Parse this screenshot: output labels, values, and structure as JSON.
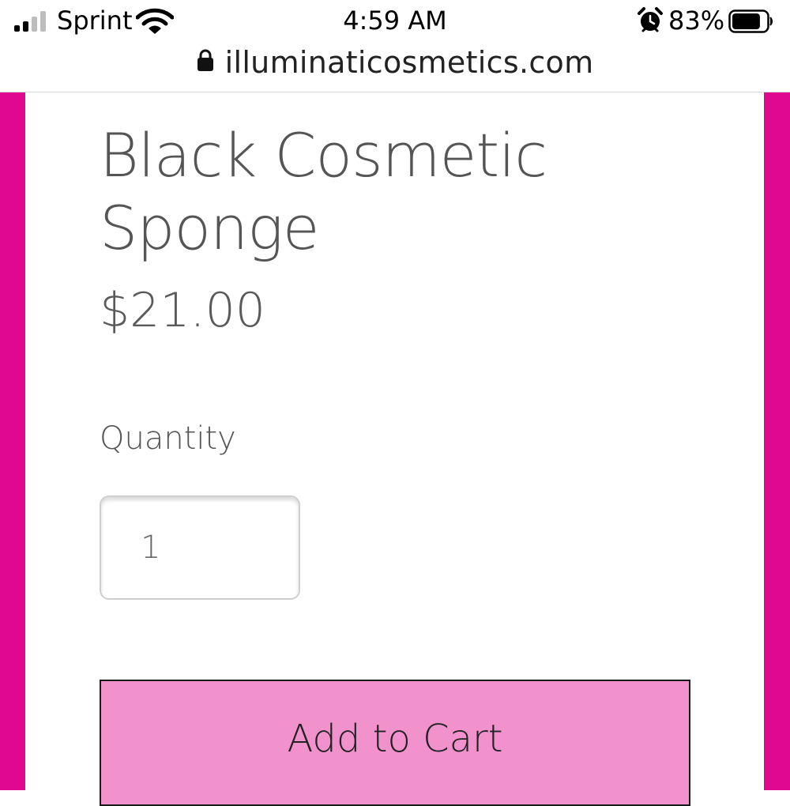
{
  "status_bar": {
    "carrier": "Sprint",
    "time": "4:59 AM",
    "battery_percent": "83%",
    "signal_bars": 2,
    "battery_level": 0.83,
    "icons": [
      "signal-icon",
      "wifi-icon",
      "alarm-icon",
      "battery-icon"
    ]
  },
  "browser": {
    "domain": "illuminaticosmetics.com",
    "icons": [
      "lock-icon"
    ]
  },
  "product": {
    "title": "Black Cosmetic Sponge",
    "price": "$21.00",
    "quantity_label": "Quantity",
    "quantity_value": "1",
    "add_to_cart_label": "Add to Cart"
  },
  "colors": {
    "accent_border": "#e0088f",
    "button_background": "#f192cd",
    "text": "#555555"
  }
}
